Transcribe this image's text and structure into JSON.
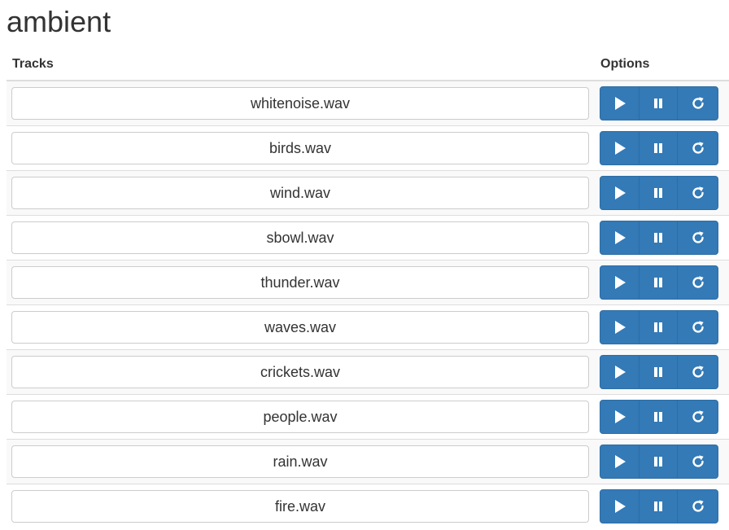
{
  "app": {
    "title": "ambient"
  },
  "table": {
    "headers": {
      "tracks": "Tracks",
      "options": "Options"
    },
    "tracks": [
      {
        "name": "whitenoise.wav"
      },
      {
        "name": "birds.wav"
      },
      {
        "name": "wind.wav"
      },
      {
        "name": "sbowl.wav"
      },
      {
        "name": "thunder.wav"
      },
      {
        "name": "waves.wav"
      },
      {
        "name": "crickets.wav"
      },
      {
        "name": "people.wav"
      },
      {
        "name": "rain.wav"
      },
      {
        "name": "fire.wav"
      }
    ],
    "row_buttons": [
      "play-icon",
      "pause-icon",
      "refresh-icon"
    ]
  },
  "colors": {
    "button_primary": "#337ab7",
    "button_border": "#2e6da4",
    "stripe": "#f9f9f9",
    "text": "#333333"
  }
}
